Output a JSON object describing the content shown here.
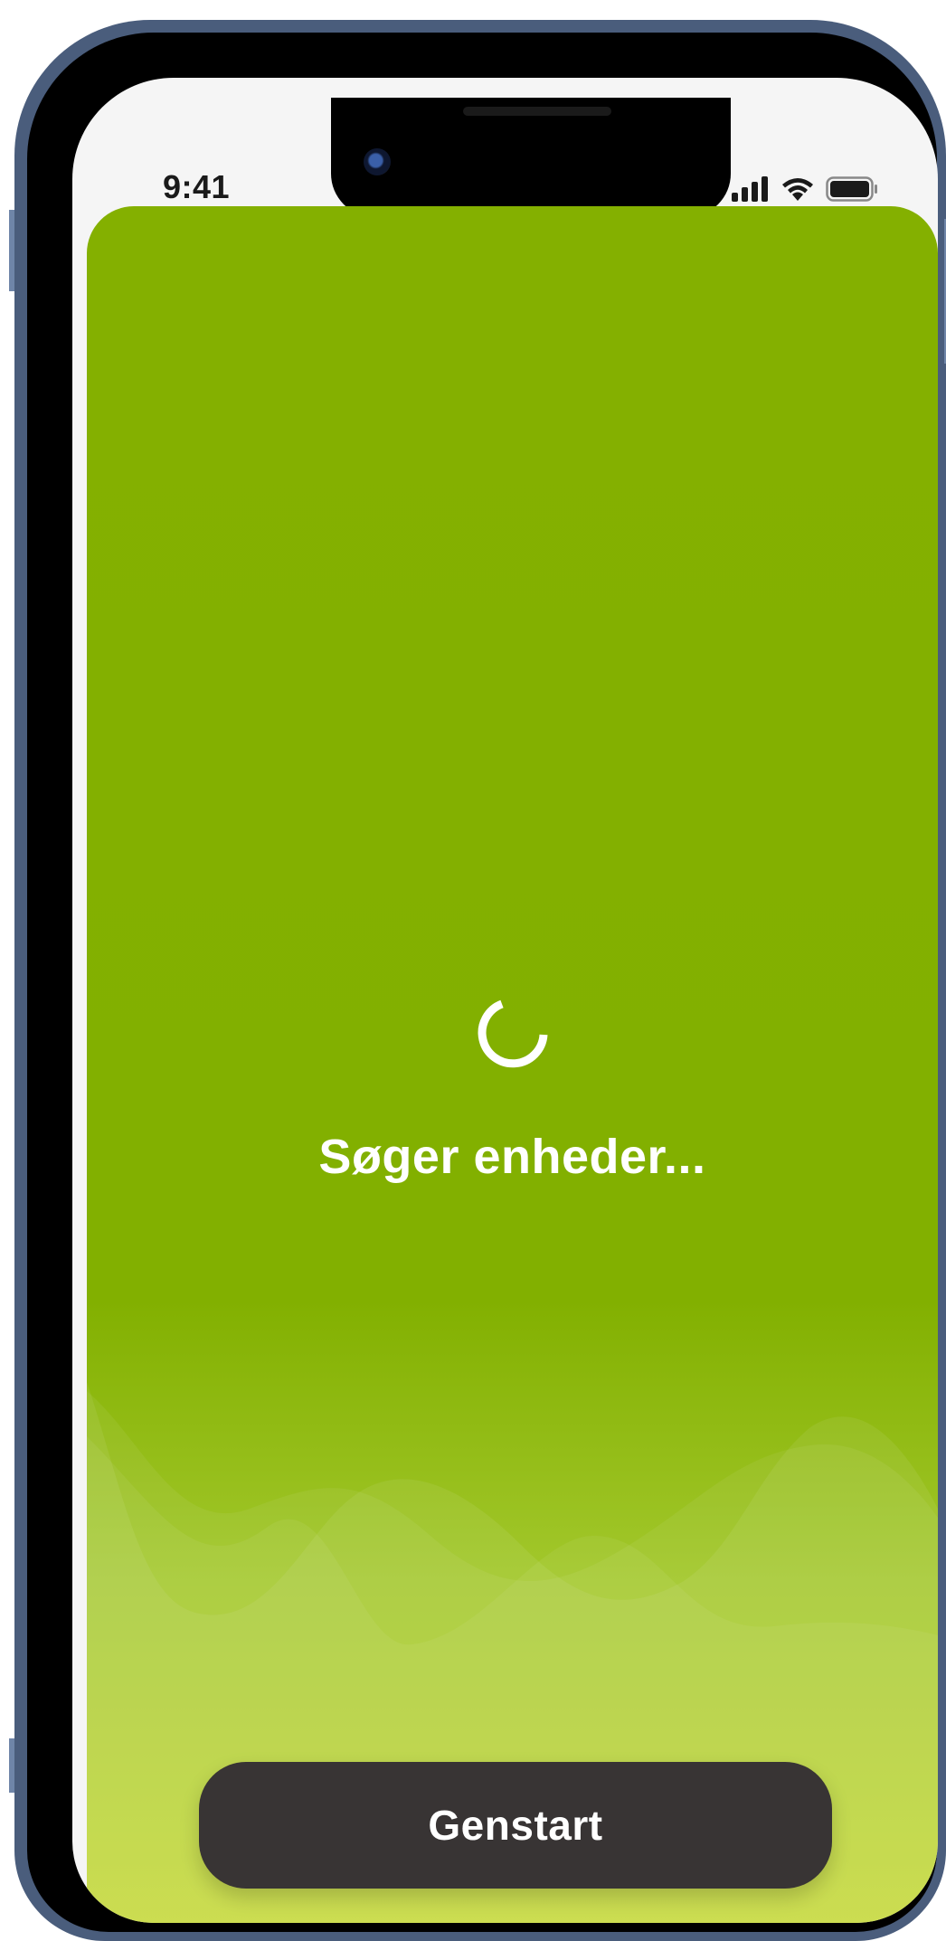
{
  "status_bar": {
    "time": "9:41",
    "icons": [
      "signal-bars-icon",
      "wifi-icon",
      "battery-icon"
    ]
  },
  "main": {
    "spinner_icon": "loading-spinner-icon",
    "message": "Søger enheder...",
    "restart_label": "Genstart"
  },
  "colors": {
    "background_green": "#84b000",
    "gradient_bottom": "#c6d92e",
    "button_dark": "#383434",
    "text": "#ffffff"
  }
}
